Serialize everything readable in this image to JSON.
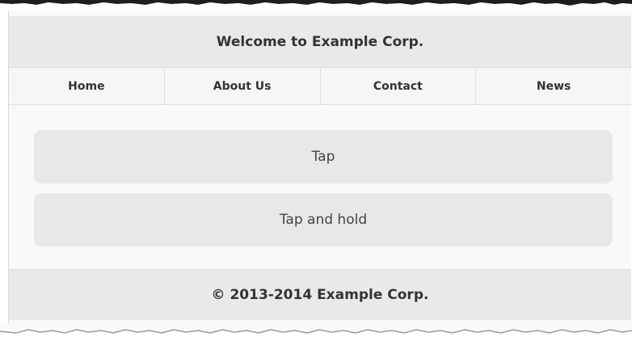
{
  "header": {
    "title": "Welcome to Example Corp."
  },
  "nav": {
    "items": [
      {
        "label": "Home"
      },
      {
        "label": "About Us"
      },
      {
        "label": "Contact"
      },
      {
        "label": "News"
      }
    ]
  },
  "main": {
    "tap_label": "Tap",
    "tap_hold_label": "Tap and hold"
  },
  "footer": {
    "text": "© 2013-2014 Example Corp."
  },
  "colors": {
    "header_bg": "#e9e9e9",
    "button_bg": "#e8e8e8",
    "page_bg": "#f9f9f9"
  }
}
